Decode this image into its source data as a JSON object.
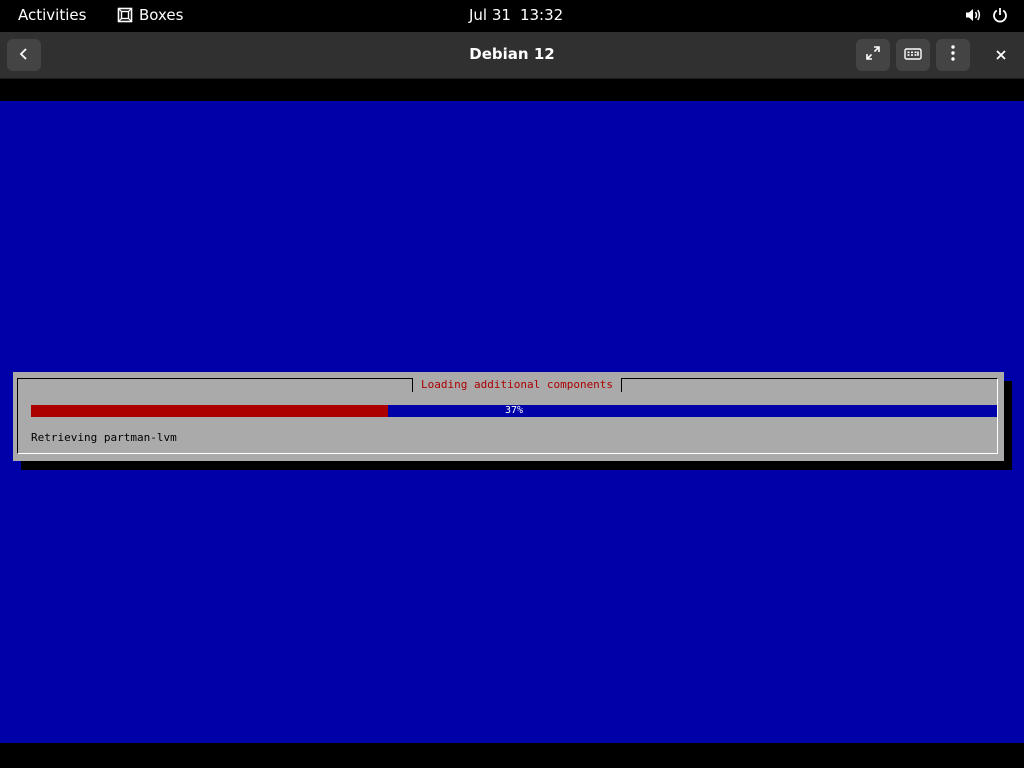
{
  "topbar": {
    "activities_label": "Activities",
    "app_name": "Boxes",
    "date": "Jul 31",
    "time": "13:32"
  },
  "window": {
    "title": "Debian 12"
  },
  "installer": {
    "dialog_title": "Loading additional components",
    "progress_fraction": 0.37,
    "progress_label": "37%",
    "status_text": "Retrieving partman-lvm"
  },
  "colors": {
    "vm_background": "#0000a8",
    "dialog_background": "#aaaaaa",
    "progress_fill": "#aa0000",
    "title_text": "#aa0000"
  },
  "icons": {
    "app": "boxes-icon",
    "volume": "volume-icon",
    "power": "power-icon",
    "back": "back-arrow-icon",
    "fullscreen": "fullscreen-icon",
    "keyboard": "keyboard-icon",
    "menu": "kebab-menu-icon",
    "close": "close-icon"
  }
}
